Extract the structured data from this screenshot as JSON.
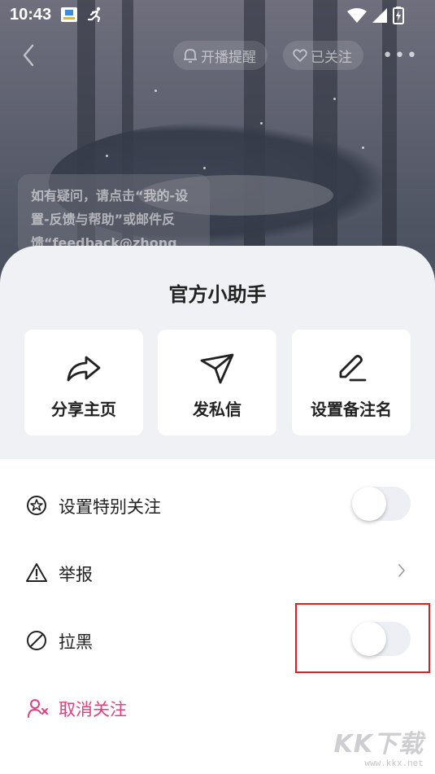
{
  "status_bar": {
    "time": "10:43"
  },
  "nav": {
    "live_reminder": "开播提醒",
    "followed": "已关注"
  },
  "message": {
    "text": "如有疑问，请点击“我的-设置-反馈与帮助”或邮件反馈“feedback@zhong"
  },
  "sheet": {
    "title": "官方小助手",
    "actions": [
      {
        "label": "分享主页",
        "icon": "share-icon"
      },
      {
        "label": "发私信",
        "icon": "send-icon"
      },
      {
        "label": "设置备注名",
        "icon": "edit-icon"
      }
    ],
    "rows": {
      "special_follow": {
        "label": "设置特别关注",
        "icon": "star-circle-icon",
        "toggle_on": false
      },
      "report": {
        "label": "举报",
        "icon": "warning-icon"
      },
      "block": {
        "label": "拉黑",
        "icon": "block-icon",
        "toggle_on": false
      },
      "unfollow": {
        "label": "取消关注",
        "icon": "user-remove-icon"
      }
    }
  },
  "colors": {
    "accent_pink": "#e0407f",
    "highlight_red": "#e02020",
    "sheet_bg": "#f0f1f5"
  },
  "watermark": {
    "logo": "KK下载",
    "url": "www.kkx.net"
  }
}
